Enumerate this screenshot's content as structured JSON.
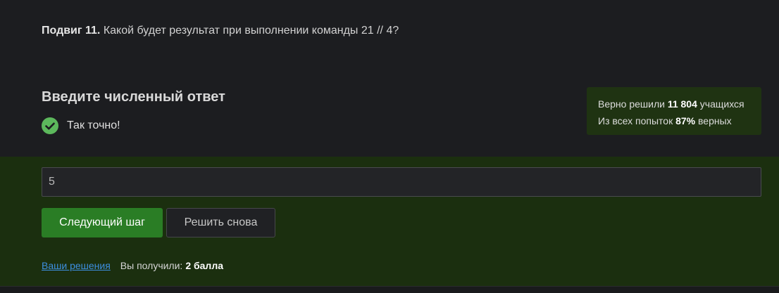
{
  "question": {
    "title": "Подвиг 11.",
    "text": "Какой будет результат при выполнении команды 21 // 4?"
  },
  "answer": {
    "heading": "Введите численный ответ",
    "status_icon": "check-circle-icon",
    "status_text": "Так точно!",
    "status_color": "#5cb85c",
    "input_value": "5"
  },
  "stats": {
    "line1_prefix": "Верно решили",
    "line1_count": "11 804",
    "line1_suffix": "учащихся",
    "line2_prefix": "Из всех попыток",
    "line2_percent": "87%",
    "line2_suffix": "верных"
  },
  "actions": {
    "next_label": "Следующий шаг",
    "retry_label": "Решить снова"
  },
  "footer": {
    "solutions_link": "Ваши решения",
    "received_label": "Вы получили:",
    "score": "2 балла"
  },
  "colors": {
    "accent_green": "#2a7d25",
    "panel_green": "#1b2f0f",
    "link_blue": "#3d8fe0"
  }
}
